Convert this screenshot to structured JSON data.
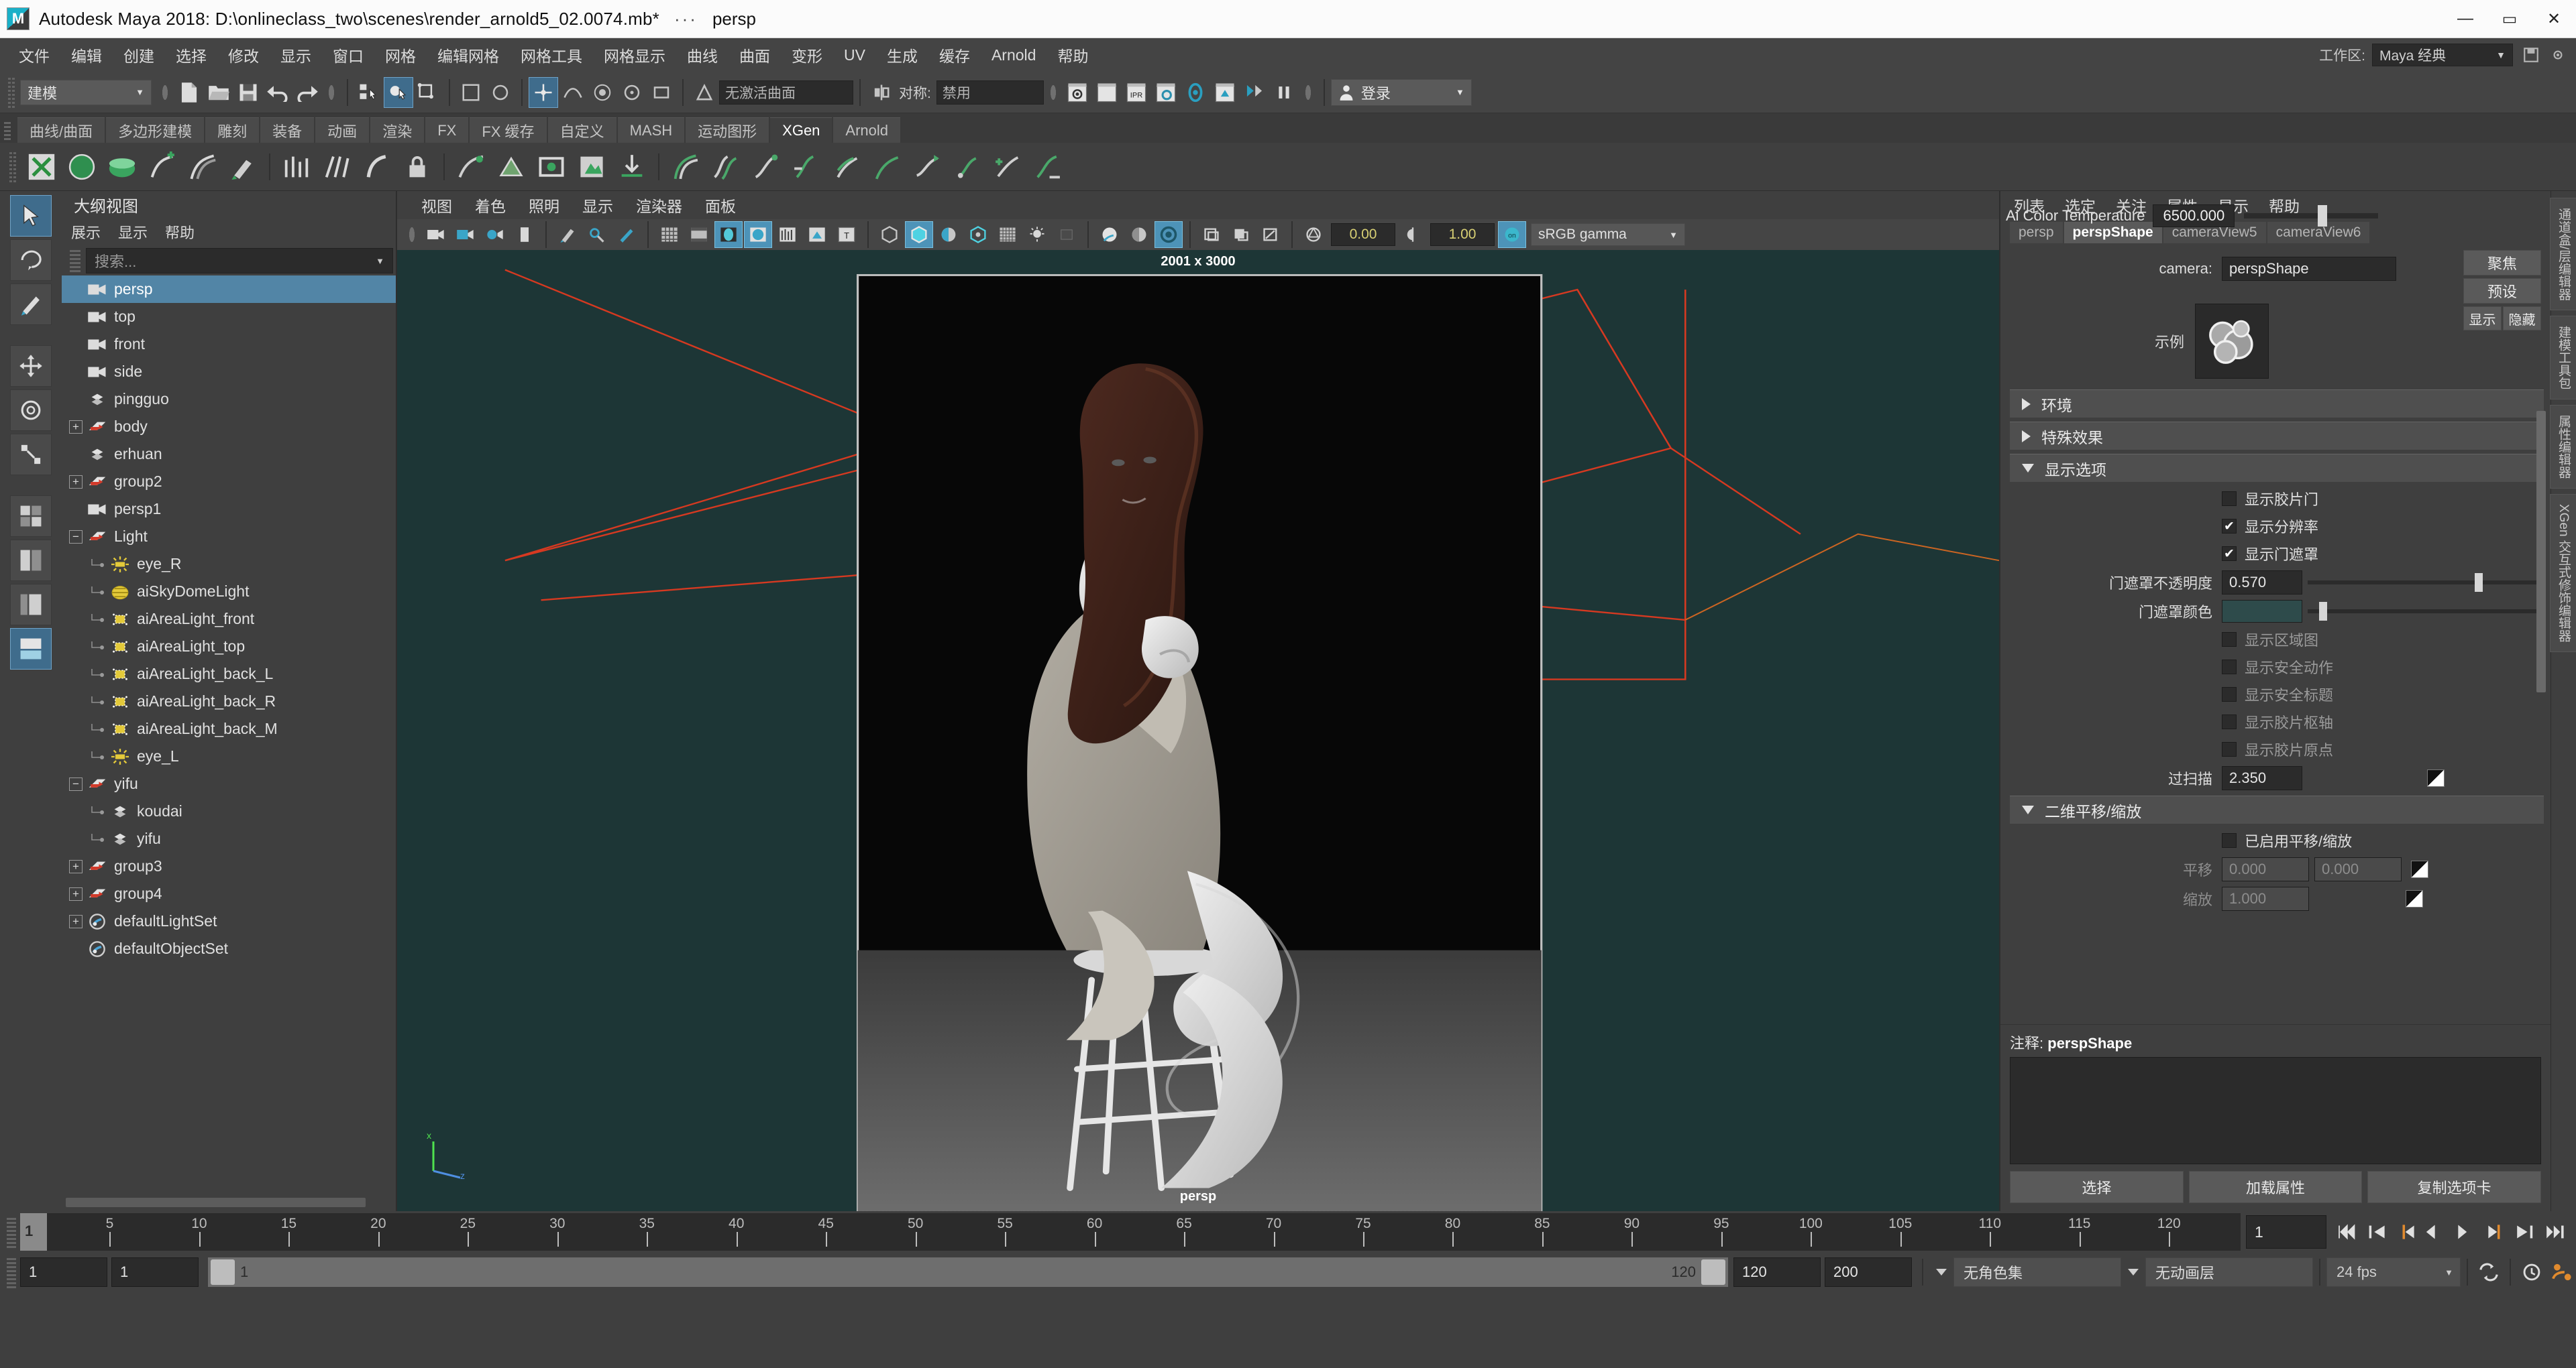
{
  "titlebar": {
    "app_title": "Autodesk Maya 2018: D:\\onlineclass_two\\scenes\\render_arnold5_02.0074.mb*",
    "dots": "···",
    "camera": "persp",
    "logo_text": "M",
    "minimize": "—",
    "maximize": "▭",
    "close": "✕"
  },
  "menubar": {
    "items": [
      "文件",
      "编辑",
      "创建",
      "选择",
      "修改",
      "显示",
      "窗口",
      "网格",
      "编辑网格",
      "网格工具",
      "网格显示",
      "曲线",
      "曲面",
      "变形",
      "UV",
      "生成",
      "缓存",
      "Arnold",
      "帮助"
    ],
    "workspace_label": "工作区:",
    "workspace_value": "Maya 经典",
    "workspace_caret": "▼"
  },
  "statusline": {
    "mode_value": "建模",
    "mode_caret": "▼",
    "live_surface_placeholder": "无激活曲面",
    "symmetry_label": "对称:",
    "symmetry_value": "禁用",
    "login_label": "登录",
    "login_caret": "▼"
  },
  "shelf": {
    "tabs": [
      "曲线/曲面",
      "多边形建模",
      "雕刻",
      "装备",
      "动画",
      "渲染",
      "FX",
      "FX 缓存",
      "自定义",
      "MASH",
      "运动图形",
      "XGen",
      "Arnold"
    ],
    "active_tab": "XGen"
  },
  "outliner": {
    "title": "大纲视图",
    "menu": [
      "展示",
      "显示",
      "帮助"
    ],
    "search_placeholder": "搜索...",
    "search_caret": "▼",
    "nodes": [
      {
        "label": "persp",
        "depth": 1,
        "icon": "camera-icon",
        "expand": "",
        "selected": true
      },
      {
        "label": "top",
        "depth": 1,
        "icon": "camera-icon",
        "expand": "",
        "selected": false
      },
      {
        "label": "front",
        "depth": 1,
        "icon": "camera-icon",
        "expand": "",
        "selected": false
      },
      {
        "label": "side",
        "depth": 1,
        "icon": "camera-icon",
        "expand": "",
        "selected": false
      },
      {
        "label": "pingguo",
        "depth": 1,
        "icon": "mesh-icon",
        "expand": "",
        "selected": false
      },
      {
        "label": "body",
        "depth": 1,
        "icon": "group-icon",
        "expand": "+",
        "selected": false
      },
      {
        "label": "erhuan",
        "depth": 1,
        "icon": "mesh-icon",
        "expand": "",
        "selected": false
      },
      {
        "label": "group2",
        "depth": 1,
        "icon": "group-icon",
        "expand": "+",
        "selected": false
      },
      {
        "label": "persp1",
        "depth": 1,
        "icon": "camera-icon",
        "expand": "",
        "selected": false
      },
      {
        "label": "Light",
        "depth": 1,
        "icon": "group-icon",
        "expand": "−",
        "selected": false
      },
      {
        "label": "eye_R",
        "depth": 2,
        "icon": "pointlight-icon",
        "expand": "",
        "selected": false
      },
      {
        "label": "aiSkyDomeLight",
        "depth": 2,
        "icon": "skydome-icon",
        "expand": "",
        "selected": false
      },
      {
        "label": "aiAreaLight_front",
        "depth": 2,
        "icon": "arealight-icon",
        "expand": "",
        "selected": false
      },
      {
        "label": "aiAreaLight_top",
        "depth": 2,
        "icon": "arealight-icon",
        "expand": "",
        "selected": false
      },
      {
        "label": "aiAreaLight_back_L",
        "depth": 2,
        "icon": "arealight-icon",
        "expand": "",
        "selected": false
      },
      {
        "label": "aiAreaLight_back_R",
        "depth": 2,
        "icon": "arealight-icon",
        "expand": "",
        "selected": false
      },
      {
        "label": "aiAreaLight_back_M",
        "depth": 2,
        "icon": "arealight-icon",
        "expand": "",
        "selected": false
      },
      {
        "label": "eye_L",
        "depth": 2,
        "icon": "pointlight-icon",
        "expand": "",
        "selected": false
      },
      {
        "label": "yifu",
        "depth": 1,
        "icon": "group-icon",
        "expand": "−",
        "selected": false
      },
      {
        "label": "koudai",
        "depth": 2,
        "icon": "mesh-icon",
        "expand": "",
        "selected": false
      },
      {
        "label": "yifu",
        "depth": 2,
        "icon": "mesh-icon",
        "expand": "",
        "selected": false
      },
      {
        "label": "group3",
        "depth": 1,
        "icon": "group-icon",
        "expand": "+",
        "selected": false
      },
      {
        "label": "group4",
        "depth": 1,
        "icon": "group-icon",
        "expand": "+",
        "selected": false
      },
      {
        "label": "defaultLightSet",
        "depth": 1,
        "icon": "set-icon",
        "expand": "+",
        "selected": false
      },
      {
        "label": "defaultObjectSet",
        "depth": 1,
        "icon": "set-icon",
        "expand": "",
        "selected": false
      }
    ]
  },
  "viewport": {
    "menu": [
      "视图",
      "着色",
      "照明",
      "显示",
      "渲染器",
      "面板"
    ],
    "exposure_value": "0.00",
    "gamma_value": "1.00",
    "color_profile": "sRGB gamma",
    "color_profile_caret": "▼",
    "resolution_label": "2001 x 3000",
    "camera_label": "persp",
    "axis_x": "x",
    "axis_z": "z"
  },
  "attribute_editor": {
    "menu": [
      "列表",
      "选定",
      "关注",
      "属性",
      "显示",
      "帮助"
    ],
    "tabs": [
      "persp",
      "perspShape",
      "cameraView5",
      "cameraView6"
    ],
    "active_tab": "perspShape",
    "tooltip_label": "Ai Color Temperature",
    "tooltip_value": "6500.000",
    "camera_label": "camera:",
    "camera_value": "perspShape",
    "focus_button": "聚焦",
    "preset_button": "预设",
    "show_button": "显示",
    "hide_button": "隐藏",
    "sample_label": "示例",
    "sections": [
      {
        "name": "环境",
        "open": false
      },
      {
        "name": "特殊效果",
        "open": false
      },
      {
        "name": "显示选项",
        "open": true
      },
      {
        "name": "二维平移/缩放",
        "open": true
      }
    ],
    "display_options": {
      "show_film_gate": {
        "label": "显示胶片门",
        "checked": false
      },
      "show_resolution": {
        "label": "显示分辨率",
        "checked": true
      },
      "show_gate_mask": {
        "label": "显示门遮罩",
        "checked": true
      },
      "gate_mask_opacity": {
        "label": "门遮罩不透明度",
        "value": "0.570",
        "slider_pct": 72
      },
      "gate_mask_color": {
        "label": "门遮罩颜色",
        "color": "#2e4b4b",
        "slider_pct": 5
      },
      "show_area_map": {
        "label": "显示区域图",
        "checked": false
      },
      "show_safe_action": {
        "label": "显示安全动作",
        "checked": false
      },
      "show_safe_title": {
        "label": "显示安全标题",
        "checked": false
      },
      "show_film_pivot": {
        "label": "显示胶片枢轴",
        "checked": false
      },
      "show_film_origin": {
        "label": "显示胶片原点",
        "checked": false
      },
      "overscan": {
        "label": "过扫描",
        "value": "2.350"
      }
    },
    "pan_zoom": {
      "enabled": {
        "label": "已启用平移/缩放",
        "checked": false
      },
      "pan": {
        "label": "平移",
        "x": "0.000",
        "y": "0.000"
      },
      "zoom": {
        "label": "缩放",
        "value": "1.000"
      }
    },
    "notes_label": "注释:",
    "notes_node": "perspShape",
    "notes_value": "",
    "buttons": [
      "选择",
      "加载属性",
      "复制选项卡"
    ],
    "side_tabs": [
      "通道盒/层编辑器",
      "建模工具包",
      "属性编辑器",
      "XGen 交互式修饰编辑器"
    ]
  },
  "timeline": {
    "current_frame": "1",
    "tick_labels": [
      "5",
      "10",
      "15",
      "20",
      "25",
      "30",
      "35",
      "40",
      "45",
      "50",
      "55",
      "60",
      "65",
      "70",
      "75",
      "80",
      "85",
      "90",
      "95",
      "100",
      "105",
      "110",
      "115",
      "120"
    ],
    "playback_frame": "1"
  },
  "range": {
    "start": "1",
    "end": "1",
    "bar_start": "1",
    "bar_end": "120",
    "anim_start": "120",
    "anim_end": "200",
    "character_set": "无角色集",
    "anim_layer": "无动画层",
    "fps": "24 fps",
    "fps_caret": "▼"
  },
  "colors": {
    "accent_blue": "#5285a6",
    "teal": "#4d93b8",
    "viewport_bg": "#1d3636",
    "panel_bg": "#3f3f3f",
    "orange": "#e08a2e"
  }
}
